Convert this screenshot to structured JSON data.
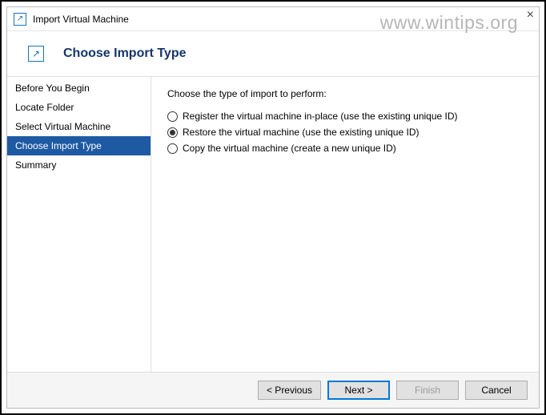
{
  "titlebar": {
    "title": "Import Virtual Machine"
  },
  "header": {
    "title": "Choose Import Type"
  },
  "sidebar": {
    "items": [
      {
        "label": "Before You Begin",
        "active": false
      },
      {
        "label": "Locate Folder",
        "active": false
      },
      {
        "label": "Select Virtual Machine",
        "active": false
      },
      {
        "label": "Choose Import Type",
        "active": true
      },
      {
        "label": "Summary",
        "active": false
      }
    ]
  },
  "main": {
    "instruction": "Choose the type of import to perform:",
    "options": [
      {
        "label": "Register the virtual machine in-place (use the existing unique ID)",
        "selected": false
      },
      {
        "label": "Restore the virtual machine (use the existing unique ID)",
        "selected": true
      },
      {
        "label": "Copy the virtual machine (create a new unique ID)",
        "selected": false
      }
    ]
  },
  "footer": {
    "previous": "< Previous",
    "next": "Next >",
    "finish": "Finish",
    "cancel": "Cancel"
  },
  "watermark": "www.wintips.org"
}
